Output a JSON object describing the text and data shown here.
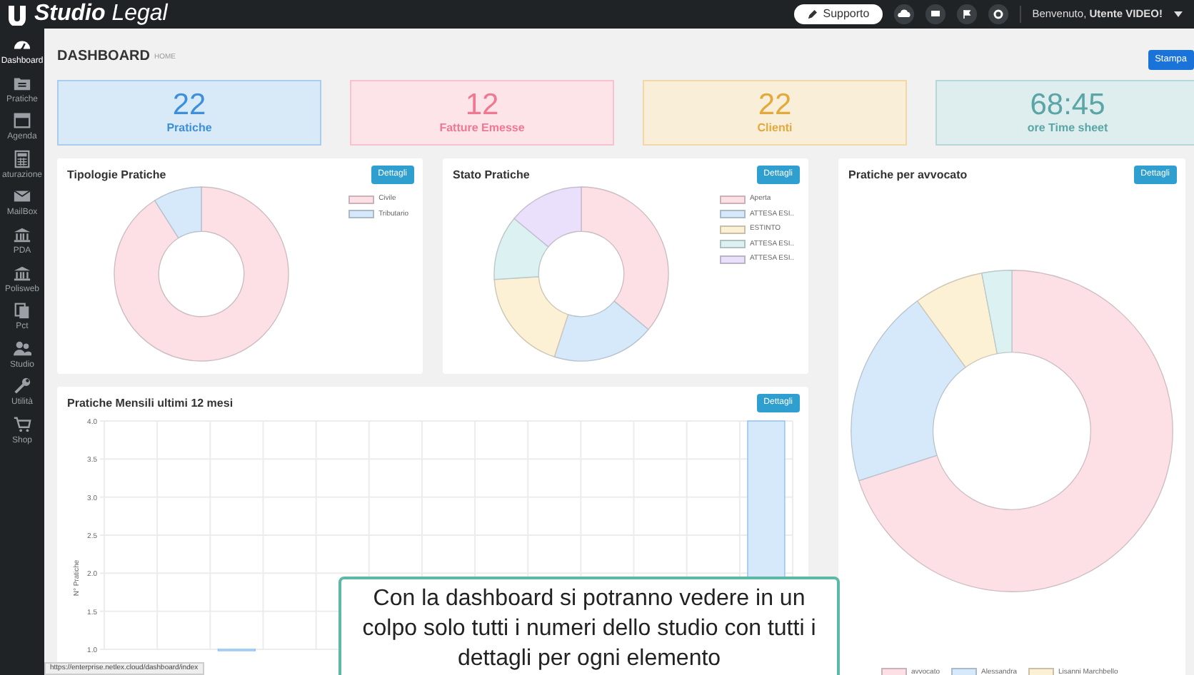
{
  "navbar": {
    "brand": "Studio Legal",
    "support_button": "Supporto",
    "user_greeting": "Benvenuto, **Utente VIDEO!**"
  },
  "sidebar": {
    "items": [
      {
        "label": "Dashboard",
        "selected": true
      },
      {
        "label": "Pratiche",
        "selected": false
      },
      {
        "label": "Agenda",
        "selected": false
      },
      {
        "label": "aturazione",
        "selected": false
      },
      {
        "label": "MailBox",
        "selected": false
      },
      {
        "label": "PDA",
        "selected": false
      },
      {
        "label": "Polisweb",
        "selected": false
      },
      {
        "label": "Pct",
        "selected": false
      },
      {
        "label": "Studio",
        "selected": false
      },
      {
        "label": "Utilità",
        "selected": false
      },
      {
        "label": "Shop",
        "selected": false
      }
    ]
  },
  "header": {
    "title": "DASHBOARD",
    "subtitle": "HOME",
    "print_button": "Stampa"
  },
  "stats": [
    {
      "value": "22",
      "label": "Pratiche",
      "color": "#3d8fd9"
    },
    {
      "value": "12",
      "label": "Fatture Emesse",
      "color": "#f07891"
    },
    {
      "value": "22",
      "label": "Clienti",
      "color": "#e2a93c"
    },
    {
      "value": "68:45",
      "label": "ore Time sheet",
      "color": "#5aa5a5"
    }
  ],
  "panels": [
    {
      "title": "Tipologie Pratiche",
      "button": "Dettagli",
      "legend": [
        {
          "label": "Civile",
          "color": "#fde0e6"
        },
        {
          "label": "Tributario",
          "color": "#d6e9fb"
        }
      ]
    },
    {
      "title": "Stato Pratiche",
      "button": "Dettagli",
      "legend": [
        {
          "label": "Aperta",
          "color": "#fde0e6"
        },
        {
          "label": "ATTESA ESI..",
          "color": "#d6e9fb"
        },
        {
          "label": "ESTINTO",
          "color": "#fdf1d5"
        },
        {
          "label": "ATTESA ESI..",
          "color": "#dcf2f2"
        },
        {
          "label": "ATTESA ESI..",
          "color": "#ebe0fb"
        }
      ]
    },
    {
      "title": "Pratiche per avvocato",
      "button": "Dettagli",
      "legend": [
        {
          "label": "avvocato",
          "color": "#fde0e6"
        },
        {
          "label": "Alessandra",
          "color": "#d6e9fb"
        },
        {
          "label": "Lisanni Marchbello",
          "color": "#fdf1d5"
        }
      ]
    }
  ],
  "monthly": {
    "title": "Pratiche Mensili ultimi 12 mesi",
    "button": "Dettagli",
    "chart_data": {
      "type": "bar",
      "ylabel": "N° Pratiche",
      "values": [
        null,
        null,
        1,
        null,
        null,
        null,
        null,
        null,
        null,
        null,
        null,
        null,
        4
      ],
      "grid": true,
      "ylim": [
        1,
        4
      ],
      "yticks": [
        {
          "value": 1,
          "label": "1.0"
        },
        {
          "value": 1.5,
          "label": "1.5"
        },
        {
          "value": 2,
          "label": "2.0"
        },
        {
          "value": 2.5,
          "label": "2.5"
        },
        {
          "value": 3,
          "label": "3.0"
        },
        {
          "value": 3.5,
          "label": "3.5"
        },
        {
          "value": 4,
          "label": "4.0"
        }
      ]
    }
  },
  "caption": "Con la dashboard si potranno vedere in un colpo solo tutti i numeri dello studio con tutti i dettagli per ogni elemento",
  "status_url": "https://enterprise.netlex.cloud/dashboard/index"
}
